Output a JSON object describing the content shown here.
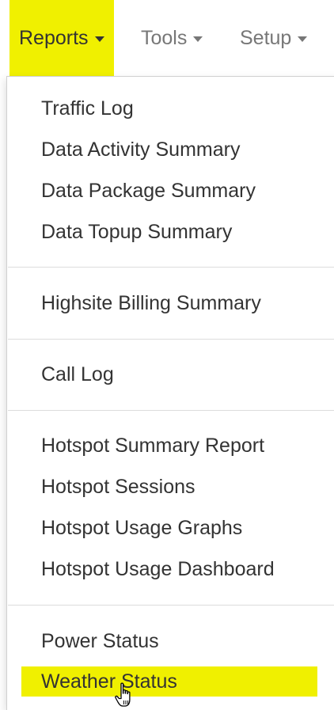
{
  "navbar": {
    "items": [
      {
        "label": "Reports",
        "active": true,
        "icon": "caret-down-icon"
      },
      {
        "label": "Tools",
        "active": false,
        "icon": "caret-down-icon"
      },
      {
        "label": "Setup",
        "active": false,
        "icon": "caret-down-icon"
      }
    ]
  },
  "dropdown": {
    "groups": [
      {
        "items": [
          "Traffic Log",
          "Data Activity Summary",
          "Data Package Summary",
          "Data Topup Summary"
        ]
      },
      {
        "items": [
          "Highsite Billing Summary"
        ]
      },
      {
        "items": [
          "Call Log"
        ]
      },
      {
        "items": [
          "Hotspot Summary Report",
          "Hotspot Sessions",
          "Hotspot Usage Graphs",
          "Hotspot Usage Dashboard"
        ]
      },
      {
        "items": [
          "Power Status",
          "Weather Status"
        ]
      }
    ],
    "hovered_item": "Weather Status"
  },
  "cursor": "hand-pointer-icon",
  "colors": {
    "highlight": "#f0f000",
    "text": "#333333",
    "nav_text": "#777777",
    "divider": "#dcdcdc"
  }
}
